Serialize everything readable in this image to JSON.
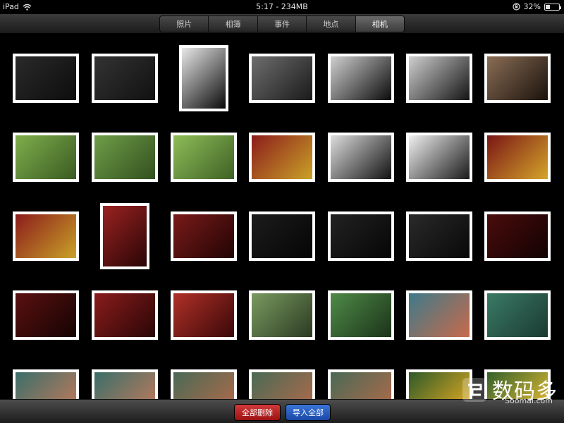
{
  "status_bar": {
    "device": "iPad",
    "wifi_icon": "wifi-icon",
    "time_memory": "5:17 - 234MB",
    "lock_icon": "orientation-lock-icon",
    "battery_percent": "32%",
    "battery_level": 0.32
  },
  "tabs": [
    {
      "label": "照片",
      "active": false
    },
    {
      "label": "相簿",
      "active": false
    },
    {
      "label": "事件",
      "active": false
    },
    {
      "label": "地点",
      "active": false
    },
    {
      "label": "相机",
      "active": true
    }
  ],
  "photos": [
    {
      "subject": "dark asphalt texture",
      "orientation": "landscape",
      "colors": [
        "#2a2a2a",
        "#0d0d0d"
      ]
    },
    {
      "subject": "dark asphalt texture",
      "orientation": "landscape",
      "colors": [
        "#333333",
        "#111111"
      ]
    },
    {
      "subject": "black and white skyscrapers looking up",
      "orientation": "portrait",
      "colors": [
        "#e8e8e8",
        "#0a0a0a"
      ]
    },
    {
      "subject": "grey asphalt texture",
      "orientation": "landscape",
      "colors": [
        "#6e6e6e",
        "#1a1a1a"
      ]
    },
    {
      "subject": "black and white silhouette photographer",
      "orientation": "landscape",
      "colors": [
        "#d0d0d0",
        "#0b0b0b"
      ]
    },
    {
      "subject": "black and white pavilion by lake",
      "orientation": "landscape",
      "colors": [
        "#cfcfcf",
        "#141414"
      ]
    },
    {
      "subject": "sepia pavilion by lake",
      "orientation": "landscape",
      "colors": [
        "#8a6d55",
        "#1a120c"
      ]
    },
    {
      "subject": "red pavilion green lawn",
      "orientation": "landscape",
      "colors": [
        "#7fae4c",
        "#3a5b22"
      ]
    },
    {
      "subject": "red pavilion green lawn",
      "orientation": "landscape",
      "colors": [
        "#6f9e48",
        "#33501f"
      ]
    },
    {
      "subject": "red pavilion green lawn",
      "orientation": "landscape",
      "colors": [
        "#8fbd58",
        "#3e6125"
      ]
    },
    {
      "subject": "golden door knocker red door",
      "orientation": "landscape",
      "colors": [
        "#8c1c1c",
        "#c9a227"
      ]
    },
    {
      "subject": "black and white door knocker",
      "orientation": "landscape",
      "colors": [
        "#dddddd",
        "#111111"
      ]
    },
    {
      "subject": "black and white door knocker",
      "orientation": "landscape",
      "colors": [
        "#f0f0f0",
        "#1a1a1a"
      ]
    },
    {
      "subject": "golden door knocker red door",
      "orientation": "landscape",
      "colors": [
        "#7a1515",
        "#d4a52a"
      ]
    },
    {
      "subject": "golden door knocker red door",
      "orientation": "landscape",
      "colors": [
        "#8c1c1c",
        "#c9a227"
      ]
    },
    {
      "subject": "red lattice doors",
      "orientation": "portrait",
      "colors": [
        "#9a2222",
        "#2a0505"
      ]
    },
    {
      "subject": "red lattice doors",
      "orientation": "landscape",
      "colors": [
        "#7a1a1a",
        "#220404"
      ]
    },
    {
      "subject": "dark lattice doors",
      "orientation": "landscape",
      "colors": [
        "#1c1c1c",
        "#050505"
      ]
    },
    {
      "subject": "dark lattice doors",
      "orientation": "landscape",
      "colors": [
        "#222222",
        "#060606"
      ]
    },
    {
      "subject": "dark lattice doors",
      "orientation": "landscape",
      "colors": [
        "#2a2a2a",
        "#080808"
      ]
    },
    {
      "subject": "dark red lattice doors",
      "orientation": "landscape",
      "colors": [
        "#4a0c0c",
        "#120202"
      ]
    },
    {
      "subject": "dark red lattice doors",
      "orientation": "landscape",
      "colors": [
        "#5a1010",
        "#150303"
      ]
    },
    {
      "subject": "red lattice doors",
      "orientation": "landscape",
      "colors": [
        "#8a1c1c",
        "#2a0606"
      ]
    },
    {
      "subject": "red lattice window",
      "orientation": "landscape",
      "colors": [
        "#b03028",
        "#3a0808"
      ]
    },
    {
      "subject": "green leaves",
      "orientation": "landscape",
      "colors": [
        "#7a9a60",
        "#2b3a22"
      ]
    },
    {
      "subject": "green leaves",
      "orientation": "landscape",
      "colors": [
        "#4f8a48",
        "#1b3319"
      ]
    },
    {
      "subject": "red and green leaves",
      "orientation": "landscape",
      "colors": [
        "#3e7a8a",
        "#c86a4a"
      ]
    },
    {
      "subject": "green leaves",
      "orientation": "landscape",
      "colors": [
        "#3a7a66",
        "#1a3a30"
      ]
    },
    {
      "subject": "leaves",
      "orientation": "landscape",
      "colors": [
        "#3a6f6a",
        "#c77a5a"
      ]
    },
    {
      "subject": "leaves",
      "orientation": "landscape",
      "colors": [
        "#3a6f6a",
        "#c77a5a"
      ]
    },
    {
      "subject": "leaves",
      "orientation": "landscape",
      "colors": [
        "#4a6a55",
        "#b56a4a"
      ]
    },
    {
      "subject": "leaves",
      "orientation": "landscape",
      "colors": [
        "#4a6a55",
        "#b56a4a"
      ]
    },
    {
      "subject": "leaves",
      "orientation": "landscape",
      "colors": [
        "#4a6a55",
        "#b56a4a"
      ]
    },
    {
      "subject": "yellow flower",
      "orientation": "landscape",
      "colors": [
        "#2e5a2a",
        "#f0b020"
      ]
    },
    {
      "subject": "yellow flower",
      "orientation": "landscape",
      "colors": [
        "#33602c",
        "#f2c233"
      ]
    }
  ],
  "toolbar": {
    "delete_all_label": "全部删除",
    "delete_color": "#b01f1f",
    "import_all_label": "导入全部",
    "import_color": "#2a5cc0"
  },
  "watermark": {
    "text": "数码多",
    "sub": "Soomal.com"
  }
}
